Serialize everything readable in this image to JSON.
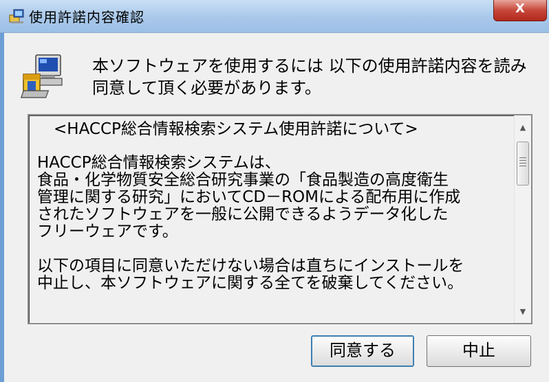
{
  "window": {
    "title": "使用許諾内容確認",
    "close_label": "X"
  },
  "message": {
    "lines": [
      "本ソフトウェアを使用するには 以下の使用許諾内容を読み",
      "同意して頂く必要があります。"
    ]
  },
  "license_text": {
    "heading": "<HACCP総合情報検索システム使用許諾について>",
    "paragraph1": [
      "HACCP総合情報検索システムは、",
      "食品・化学物質安全総合研究事業の「食品製造の高度衛生",
      "管理に関する研究」においてCD－ROMによる配布用に作成",
      "されたソフトウェアを一般に公開できるようデータ化した",
      "フリーウェアです。"
    ],
    "paragraph2": [
      "以下の項目に同意いただけない場合は直ちにインストールを",
      "中止し、本ソフトウェアに関する全てを破棄してください。"
    ]
  },
  "buttons": {
    "agree_label": "同意する",
    "cancel_label": "中止"
  },
  "icons": {
    "title": "installer-icon",
    "message": "computer-setup-icon"
  }
}
